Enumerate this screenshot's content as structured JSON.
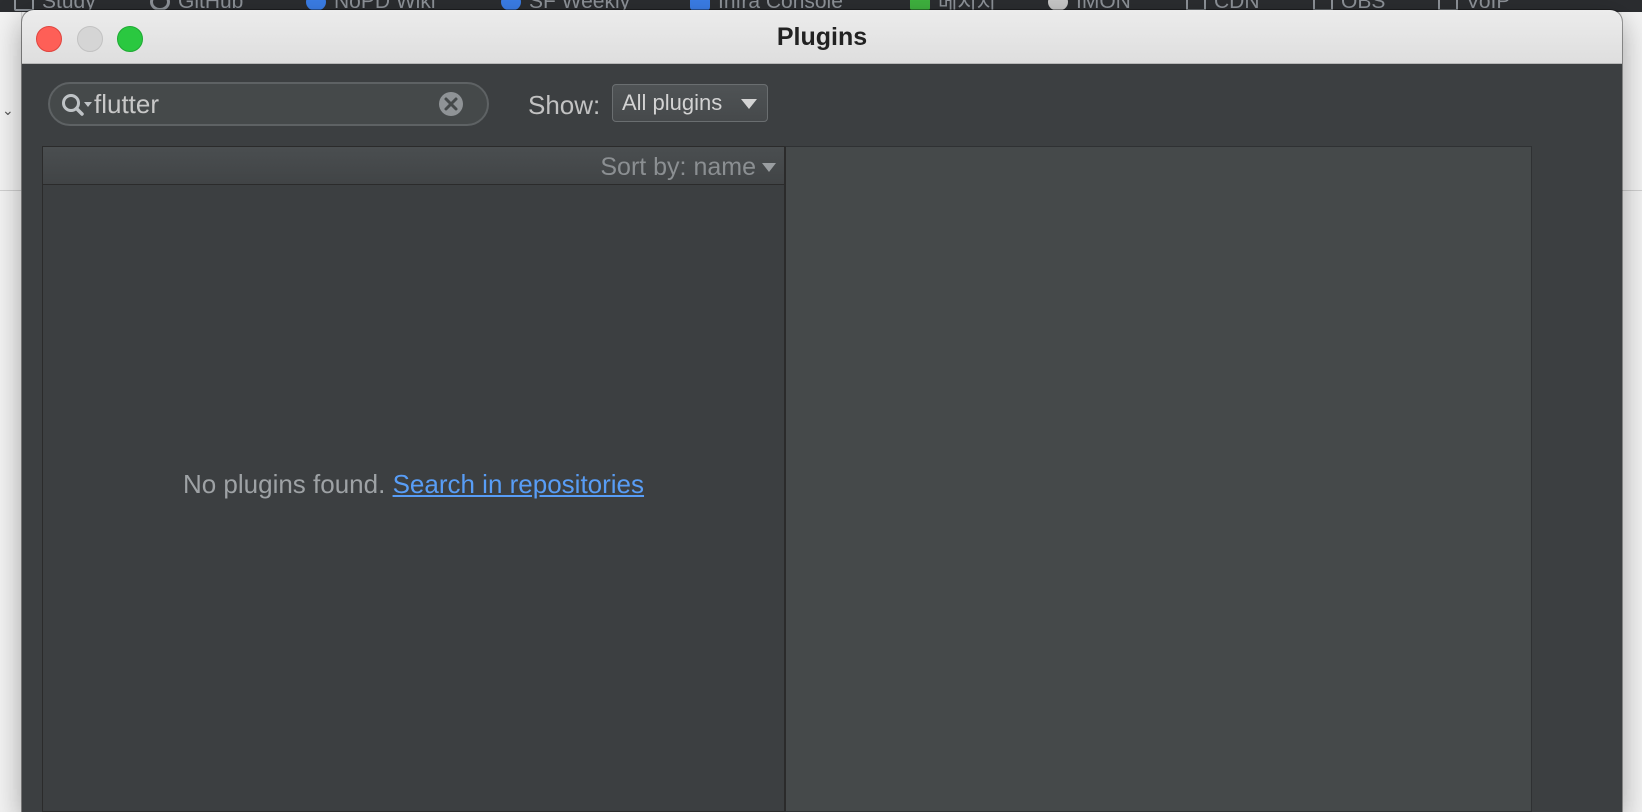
{
  "background_browser": {
    "bookmarks": [
      {
        "label": "Study",
        "icon": "folder-icon"
      },
      {
        "label": "GitHub",
        "icon": "github-icon"
      },
      {
        "label": "NoPD Wiki",
        "icon": "wiki-icon"
      },
      {
        "label": "SF Weekly",
        "icon": "wiki-icon"
      },
      {
        "label": "Infra Console",
        "icon": "console-icon"
      },
      {
        "label": "메시지",
        "icon": "messenger-icon"
      },
      {
        "label": "IMON",
        "icon": "globe-icon"
      },
      {
        "label": "CDN",
        "icon": "folder-icon"
      },
      {
        "label": "OBS",
        "icon": "folder-icon"
      },
      {
        "label": "VoIP",
        "icon": "folder-icon"
      }
    ]
  },
  "window": {
    "title": "Plugins",
    "controls": [
      "close",
      "minimize",
      "maximize"
    ]
  },
  "toolbar": {
    "search": {
      "value": "flutter",
      "icon": "search-icon",
      "clear_icon": "clear-icon"
    },
    "show_label": "Show:",
    "show_select": {
      "value": "All plugins",
      "icon": "chevron-down-icon"
    }
  },
  "plugin_list": {
    "sort_label": "Sort by: name",
    "empty_message": "No plugins found.",
    "empty_link": "Search in repositories"
  },
  "colors": {
    "background": "#3c3f41",
    "detail_panel": "#45494a",
    "link": "#589df6",
    "close": "#fe5f57",
    "maximize": "#2ac840"
  }
}
